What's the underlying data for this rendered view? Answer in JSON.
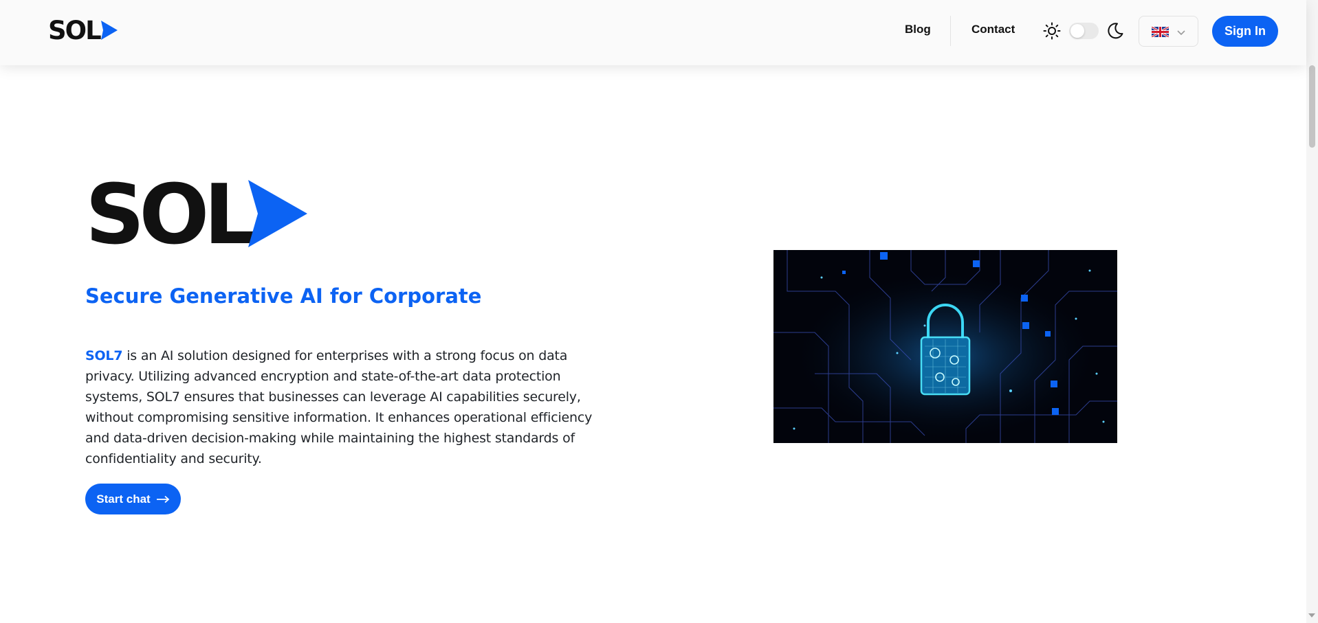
{
  "brand": {
    "logo_text": "SOL",
    "accent_color": "#0c63f3"
  },
  "nav": {
    "blog": "Blog",
    "contact": "Contact",
    "theme_light_icon": "sun-icon",
    "theme_dark_icon": "moon-icon",
    "language_flag": "uk-flag",
    "sign_in": "Sign In"
  },
  "hero": {
    "title": "Secure Generative AI for Corporate",
    "brand_name": "SOL7",
    "description": " is an AI solution designed for enterprises with a strong focus on data privacy. Utilizing advanced encryption and state-of-the-art data protection systems, SOL7 ensures that businesses can leverage AI capabilities securely, without compromising sensitive information. It enhances operational efficiency and data-driven decision-making while maintaining the highest standards of confidentiality and security.",
    "cta": "Start chat",
    "image_icon": "padlock-circuit-image"
  }
}
